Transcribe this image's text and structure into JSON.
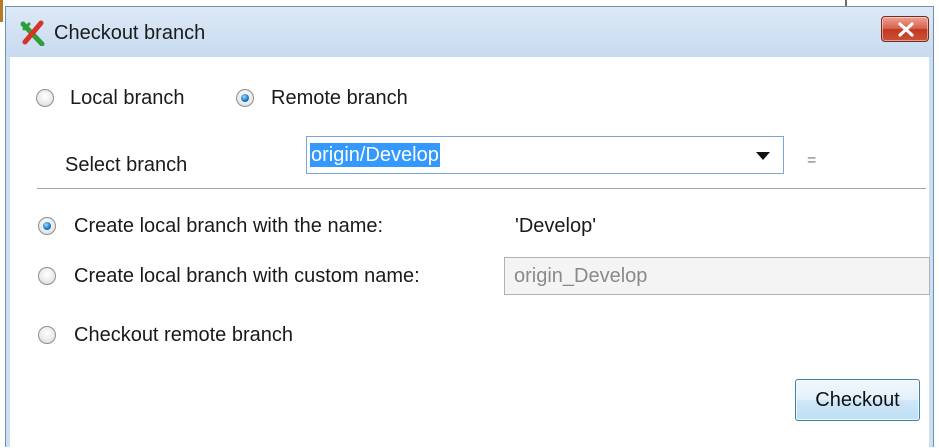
{
  "window": {
    "title": "Checkout branch",
    "app_icon": "git-cross-icon",
    "close_icon": "close-x-icon"
  },
  "source": {
    "local_label": "Local branch",
    "remote_label": "Remote branch",
    "selected": "remote"
  },
  "branch_select": {
    "label": "Select branch",
    "value": "origin/Develop",
    "trailing_symbol": "="
  },
  "options": {
    "create_named_label": "Create local branch with the name:",
    "create_named_value": "'Develop'",
    "create_custom_label": "Create local branch with custom name:",
    "create_custom_value": "origin_Develop",
    "checkout_remote_label": "Checkout remote branch",
    "selected": "create_named"
  },
  "actions": {
    "checkout_label": "Checkout"
  },
  "colors": {
    "selection": "#3399ff",
    "close_button": "#c1391f",
    "titlebar": "#cde0f3"
  }
}
